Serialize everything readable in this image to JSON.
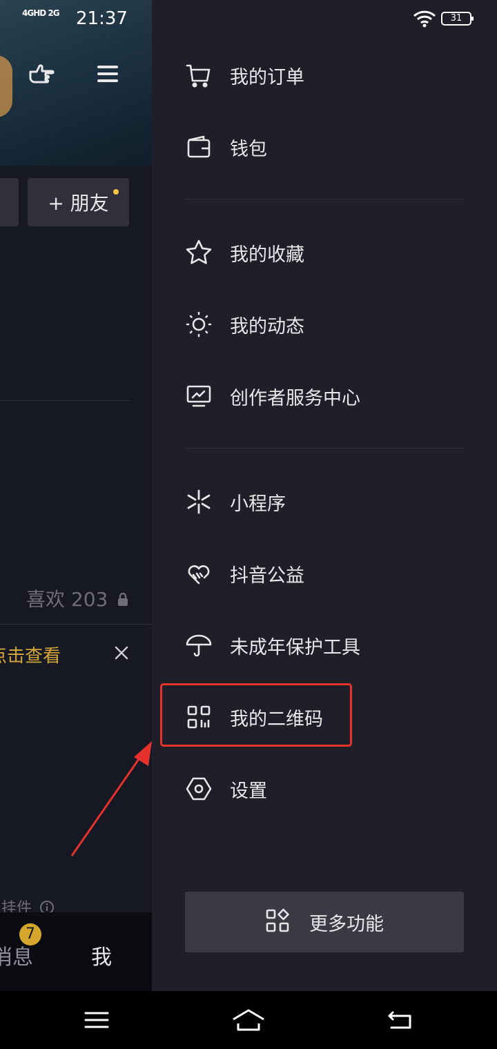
{
  "status_bar": {
    "network": "4GHD 2G",
    "time": "21:37",
    "battery": "31"
  },
  "profile_bg": {
    "add_friend": "+ 朋友",
    "likes": "喜欢 203",
    "view_link": "点击查看",
    "pendant_text": "像挂件",
    "tab_messages": "消息",
    "messages_badge": "7",
    "tab_me": "我"
  },
  "drawer": {
    "items": [
      {
        "label": "我的订单",
        "icon": "cart-icon"
      },
      {
        "label": "钱包",
        "icon": "wallet-icon"
      },
      {
        "label": "我的收藏",
        "icon": "star-icon"
      },
      {
        "label": "我的动态",
        "icon": "sun-icon"
      },
      {
        "label": "创作者服务中心",
        "icon": "monitor-chart-icon"
      },
      {
        "label": "小程序",
        "icon": "spark-icon"
      },
      {
        "label": "抖音公益",
        "icon": "heart-hands-icon"
      },
      {
        "label": "未成年保护工具",
        "icon": "umbrella-icon"
      },
      {
        "label": "我的二维码",
        "icon": "qr-code-icon"
      },
      {
        "label": "设置",
        "icon": "hexagon-gear-icon"
      }
    ],
    "more_label": "更多功能"
  },
  "colors": {
    "drawer_bg": "#1e1f29",
    "page_bg": "#161823",
    "highlight": "#e5322d",
    "accent_gold": "#d3a63b"
  }
}
